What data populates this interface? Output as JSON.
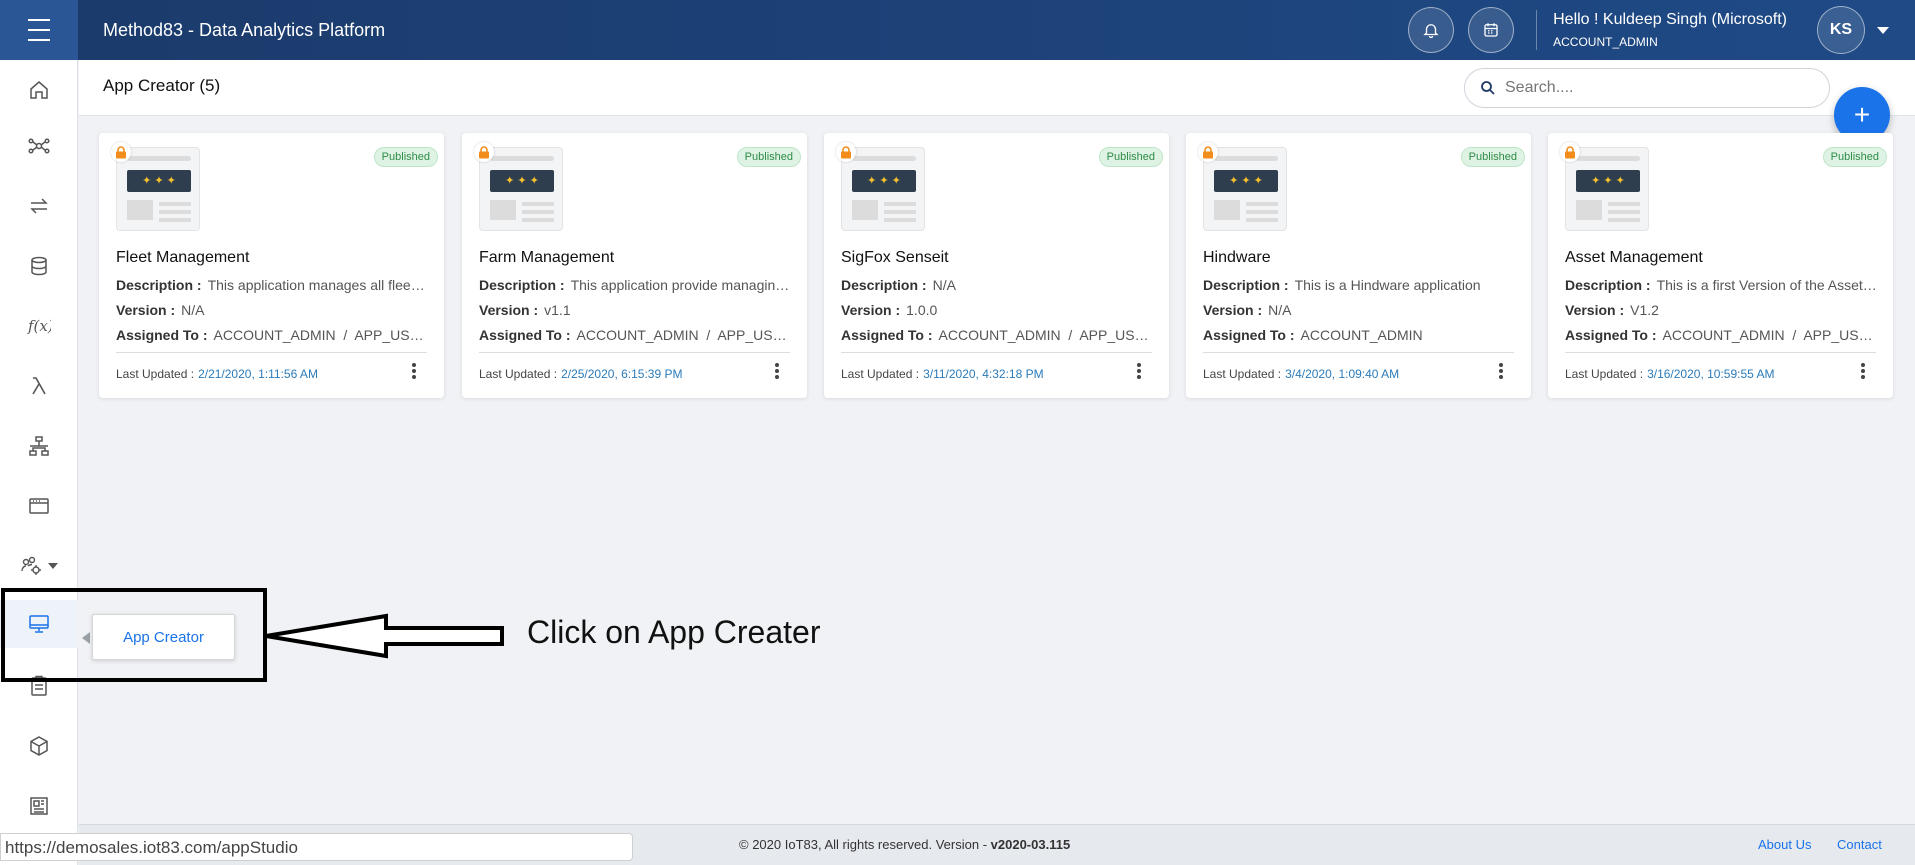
{
  "header": {
    "title": "Method83 - Data Analytics Platform",
    "greeting": "Hello ! Kuldeep Singh (Microsoft)",
    "role": "ACCOUNT_ADMIN",
    "avatar_initials": "KS"
  },
  "page": {
    "title": "App Creator (5)",
    "search_placeholder": "Search....",
    "add_label": "+"
  },
  "labels": {
    "description": "Description :",
    "version": "Version :",
    "assigned_to": "Assigned To :",
    "last_updated": "Last Updated :",
    "published": "Published"
  },
  "cards": [
    {
      "title": "Fleet Management",
      "description": "This application manages all fleet vehicles",
      "version": "N/A",
      "assigned": "ACCOUNT_ADMIN  /  APP_USER",
      "updated": "2/21/2020, 1:11:56 AM"
    },
    {
      "title": "Farm Management",
      "description": "This application provide managing farms",
      "version": "v1.1",
      "assigned": "ACCOUNT_ADMIN  /  APP_USER",
      "updated": "2/25/2020, 6:15:39 PM"
    },
    {
      "title": "SigFox Senseit",
      "description": "N/A",
      "version": "1.0.0",
      "assigned": "ACCOUNT_ADMIN  /  APP_USER",
      "updated": "3/11/2020, 4:32:18 PM"
    },
    {
      "title": "Hindware",
      "description": "This is a Hindware application",
      "version": "N/A",
      "assigned": "ACCOUNT_ADMIN",
      "updated": "3/4/2020, 1:09:40 AM"
    },
    {
      "title": "Asset Management",
      "description": "This is a first Version of the Asset Management",
      "version": "V1.2",
      "assigned": "ACCOUNT_ADMIN  /  APP_USER",
      "updated": "3/16/2020, 10:59:55 AM"
    }
  ],
  "sidebar": {
    "tooltip": "App Creator",
    "icons": [
      "home-icon",
      "network-icon",
      "transfer-icon",
      "database-icon",
      "function-icon",
      "lambda-icon",
      "hierarchy-icon",
      "window-icon",
      "settings-group-icon",
      "desktop-icon",
      "clipboard-icon",
      "cube-icon",
      "dashboard-icon"
    ]
  },
  "annotation": {
    "text": "Click on App Creater"
  },
  "footer": {
    "copyright": "© 2020 IoT83, All rights reserved. Version - ",
    "version": "v2020-03.115",
    "about": "About Us",
    "contact": "Contact"
  },
  "statusbar": {
    "url": "https://demosales.iot83.com/appStudio"
  },
  "colors": {
    "header": "#1b3a6b",
    "accent": "#1a73e8",
    "published_bg": "#dff3e4",
    "lock": "#f28c1b"
  }
}
